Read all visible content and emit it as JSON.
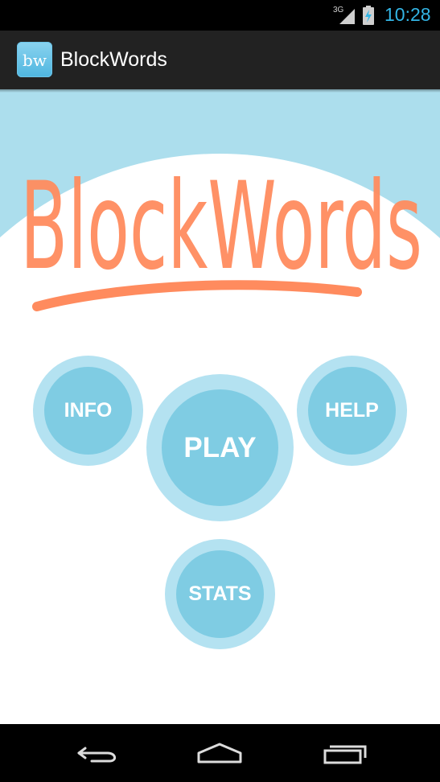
{
  "status_bar": {
    "network": "3G",
    "time": "10:28",
    "icons": [
      "signal-icon",
      "battery-charging-icon"
    ],
    "time_color": "#33b5e5"
  },
  "action_bar": {
    "logo_text": "bw",
    "title": "BlockWords"
  },
  "main": {
    "logo_text": "BlockWords",
    "logo_color": "#ff8b5e",
    "buttons": {
      "info": "INFO",
      "play": "PLAY",
      "help": "HELP",
      "stats": "STATS"
    },
    "colors": {
      "background": "#acdeed",
      "circle": "#ffffff",
      "button_outer": "#b4e2f1",
      "button_inner": "#7fcce3"
    }
  },
  "nav_bar": {
    "icons": [
      "back-icon",
      "home-icon",
      "recents-icon"
    ]
  }
}
